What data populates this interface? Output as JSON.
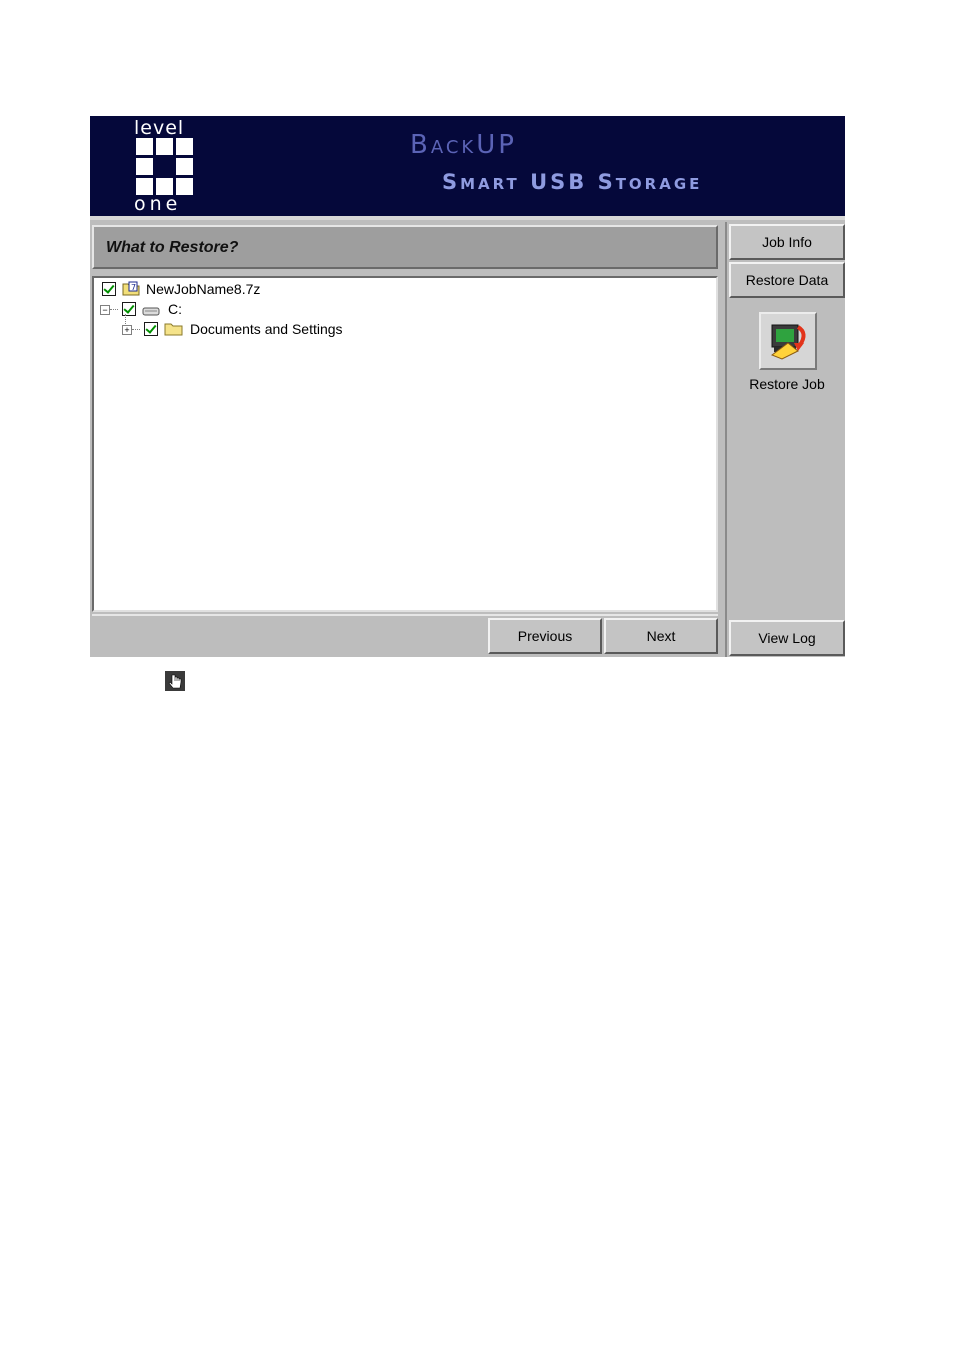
{
  "banner": {
    "logo_top": "level",
    "logo_bottom": "one",
    "title": "BackUP",
    "subtitle": "Smart USB Storage"
  },
  "main": {
    "header": "What to Restore?",
    "tree": [
      {
        "label": "NewJobName8.7z",
        "icon": "archive-file-icon",
        "checked": true
      },
      {
        "label": "C:",
        "icon": "drive-icon",
        "checked": true,
        "expanded": true
      },
      {
        "label": "Documents and Settings",
        "icon": "folder-icon",
        "checked": true,
        "expanded": false
      }
    ],
    "previous_label": "Previous",
    "next_label": "Next"
  },
  "sidebar": {
    "job_info_label": "Job Info",
    "restore_data_label": "Restore Data",
    "restore_job_label": "Restore Job",
    "view_log_label": "View Log"
  },
  "colors": {
    "banner_bg": "#05083a",
    "panel_bg": "#bdbdbd",
    "header_bg": "#9e9e9e",
    "check_green": "#009000"
  }
}
